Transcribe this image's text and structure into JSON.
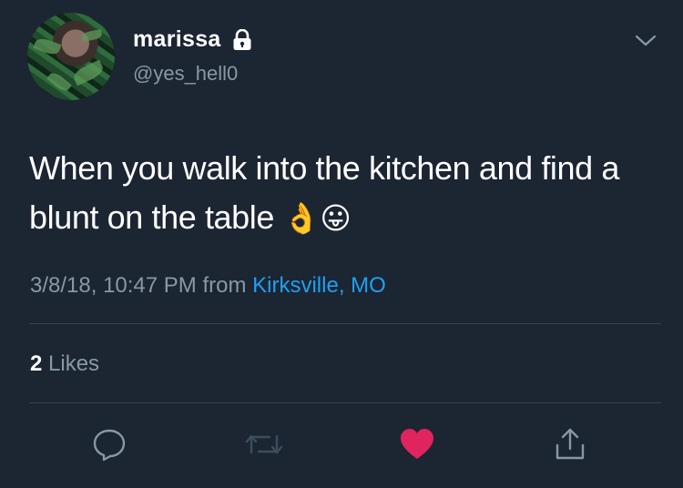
{
  "user": {
    "display_name": "marissa",
    "handle": "@yes_hell0",
    "protected_icon": "lock-icon"
  },
  "tweet": {
    "text": "When you walk into the kitchen and find a blunt on the table",
    "emojis": "👌😛",
    "date_time": "3/8/18, 10:47 PM",
    "from_label": "from",
    "location": "Kirksville, MO"
  },
  "stats": {
    "like_count": "2",
    "like_label": "Likes"
  },
  "actions": {
    "reply_icon": "reply-icon",
    "retweet_icon": "retweet-icon",
    "like_icon": "heart-icon",
    "share_icon": "share-icon"
  },
  "colors": {
    "background": "#1c2532",
    "secondary_text": "#8899a6",
    "link": "#1da1f2",
    "like_active": "#e0245e",
    "divider": "#38444d"
  }
}
